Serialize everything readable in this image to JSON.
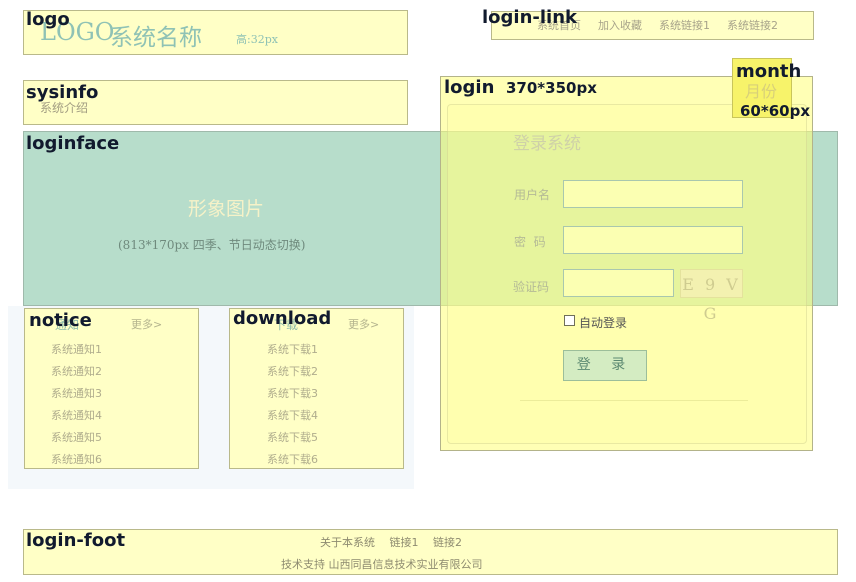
{
  "annotations": {
    "logo": "logo",
    "login_link": "login-link",
    "sysinfo": "sysinfo",
    "login": "login",
    "login_size": "370*350px",
    "month": "month",
    "month_size": "60*60px",
    "loginface": "loginface",
    "notice": "notice",
    "download": "download",
    "login_foot": "login-foot"
  },
  "logo": {
    "logo_text": "LOGO",
    "system_name": "系统名称",
    "height_note": "高:32px"
  },
  "login_link": {
    "items": [
      "系统首页",
      "加入收藏",
      "系统链接1",
      "系统链接2"
    ]
  },
  "sysinfo": {
    "text": "系统介绍"
  },
  "loginface": {
    "title": "形象图片",
    "subtitle": "(813*170px 四季、节日动态切换)"
  },
  "login": {
    "title": "登录系统",
    "username_label": "用户名",
    "password_label": "密  码",
    "captcha_label": "验证码",
    "captcha_text": "E 9 V G",
    "remember_label": "自动登录",
    "submit_label": "登 录"
  },
  "month": {
    "text": "月份"
  },
  "notice": {
    "title": "通知",
    "more": "更多>",
    "items": [
      "系统通知1",
      "系统通知2",
      "系统通知3",
      "系统通知4",
      "系统通知5",
      "系统通知6"
    ]
  },
  "download": {
    "title": "下载",
    "more": "更多>",
    "items": [
      "系统下载1",
      "系统下载2",
      "系统下载3",
      "系统下载4",
      "系统下载5",
      "系统下载6"
    ]
  },
  "footer": {
    "links": [
      "关于本系统",
      "链接1",
      "链接2"
    ],
    "support": "技术支持 山西同昌信息技术实业有限公司"
  },
  "colors": {
    "yellow_block": "#ffffc6",
    "face_block": "#b7ddcb",
    "login_overlay": "#ffff78",
    "month_block": "#f7f36a",
    "accent_text": "#8fc2b5"
  }
}
